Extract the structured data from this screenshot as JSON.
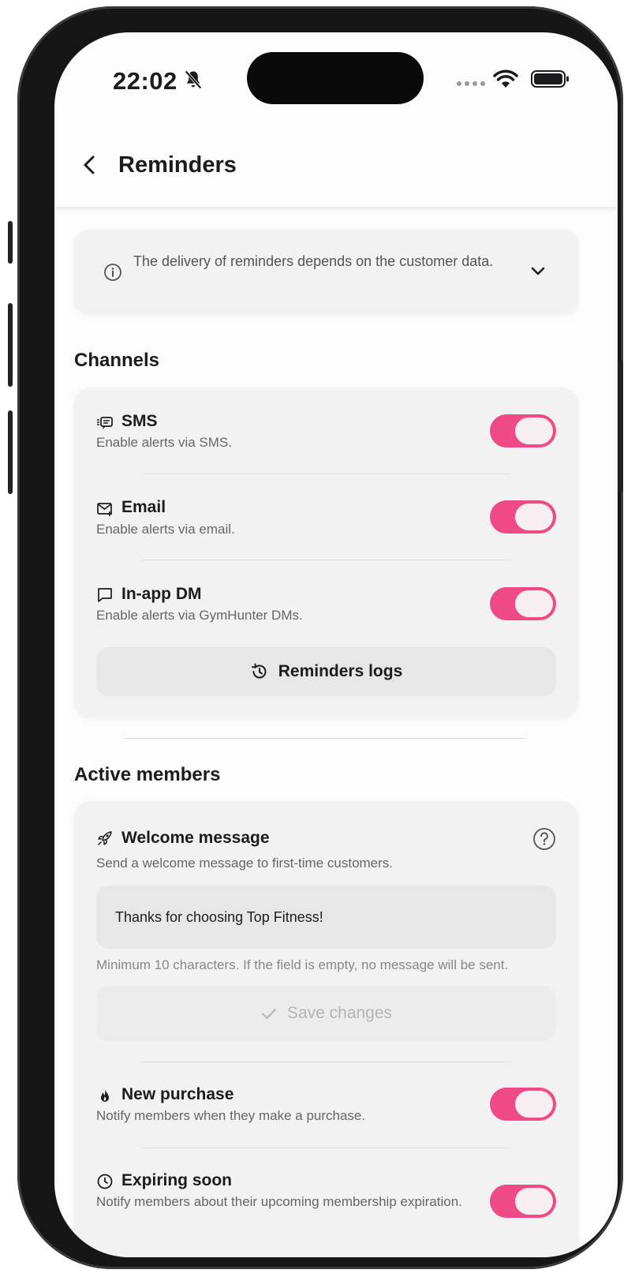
{
  "status_bar": {
    "time": "22:02"
  },
  "header": {
    "title": "Reminders"
  },
  "info": {
    "text": "The delivery of reminders depends on the customer data."
  },
  "channels": {
    "section_title": "Channels",
    "items": [
      {
        "title": "SMS",
        "desc": "Enable alerts via SMS.",
        "icon": "sms-icon",
        "enabled": true
      },
      {
        "title": "Email",
        "desc": "Enable alerts via email.",
        "icon": "email-icon",
        "enabled": true
      },
      {
        "title": "In-app DM",
        "desc": "Enable alerts via GymHunter DMs.",
        "icon": "chat-icon",
        "enabled": true
      }
    ],
    "logs_button": "Reminders logs"
  },
  "active_members": {
    "section_title": "Active members",
    "welcome": {
      "title": "Welcome message",
      "desc": "Send a welcome message to first-time customers.",
      "input_value": "Thanks for choosing Top Fitness!",
      "hint": "Minimum 10 characters. If the field is empty, no message will be sent.",
      "save_label": "Save changes"
    },
    "items": [
      {
        "title": "New purchase",
        "desc": "Notify members when they make a purchase.",
        "icon": "flame-icon",
        "enabled": true
      },
      {
        "title": "Expiring soon",
        "desc": "Notify members about their upcoming membership expiration.",
        "icon": "clock-icon",
        "enabled": true
      }
    ]
  },
  "colors": {
    "toggle_on": "#ef4a86",
    "card_bg": "#f2f2f2",
    "screen_bg": "#fcfcfc"
  }
}
